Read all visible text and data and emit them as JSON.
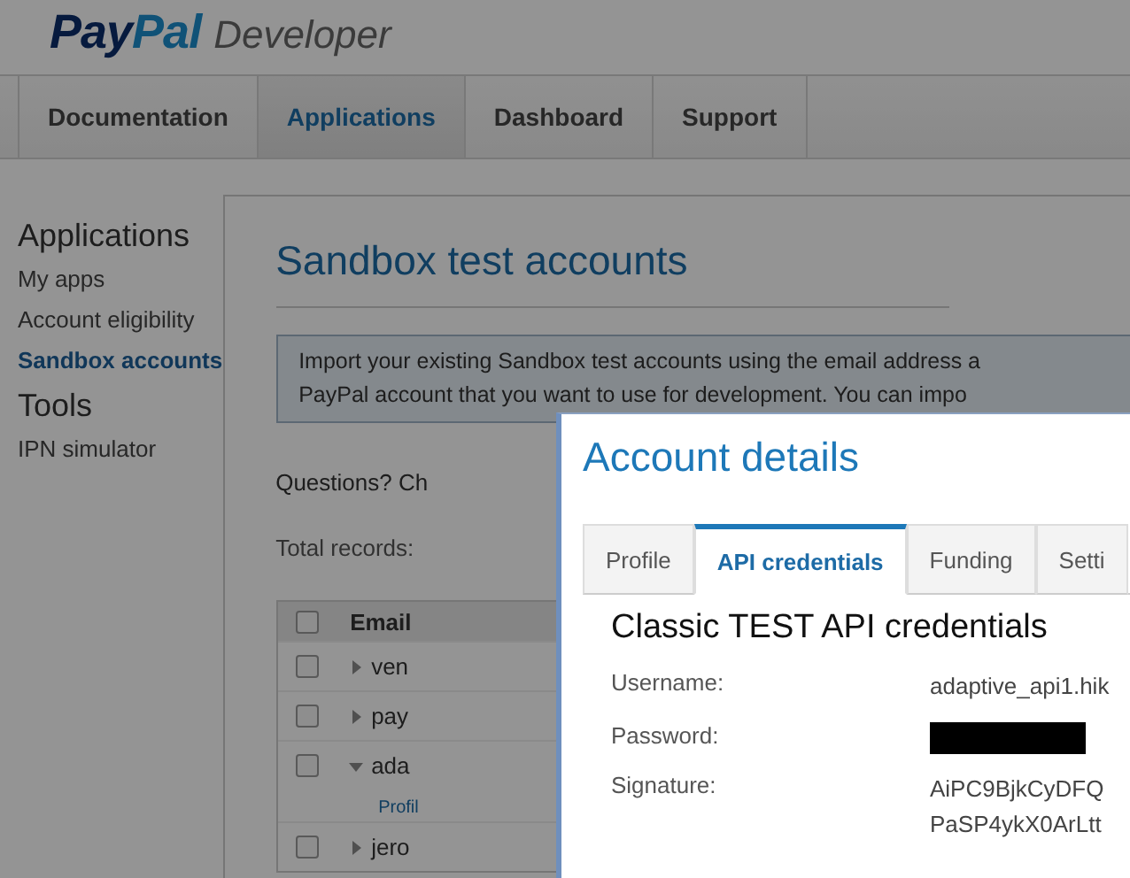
{
  "header": {
    "logo": {
      "brand_first": "Pay",
      "brand_second": "Pal",
      "product": "Developer"
    }
  },
  "nav_tabs": [
    {
      "label": "Documentation",
      "selected": false
    },
    {
      "label": "Applications",
      "selected": true
    },
    {
      "label": "Dashboard",
      "selected": false
    },
    {
      "label": "Support",
      "selected": false
    }
  ],
  "sidebar": {
    "sections": [
      {
        "title": "Applications",
        "items": [
          {
            "label": "My apps",
            "selected": false
          },
          {
            "label": "Account eligibility",
            "selected": false
          },
          {
            "label": "Sandbox accounts",
            "selected": true
          }
        ]
      },
      {
        "title": "Tools",
        "items": [
          {
            "label": "IPN simulator",
            "selected": false
          }
        ]
      }
    ]
  },
  "main": {
    "title": "Sandbox test accounts",
    "notice": [
      "Import your existing Sandbox test accounts using the email address a",
      "PayPal account that you want to use for development. You can impo"
    ],
    "questions": "Questions? Ch",
    "total_records": "Total records:",
    "table": {
      "columns": [
        "Email"
      ],
      "header_checked": false,
      "rows": [
        {
          "email": "ven",
          "checked": false,
          "expanded": false
        },
        {
          "email": "pay",
          "checked": false,
          "expanded": false
        },
        {
          "email": "ada",
          "checked": false,
          "expanded": true,
          "links": [
            "Profil"
          ]
        },
        {
          "email": "jero",
          "checked": false,
          "expanded": false
        }
      ]
    }
  },
  "modal": {
    "title": "Account details",
    "tabs": [
      {
        "label": "Profile",
        "selected": false
      },
      {
        "label": "API credentials",
        "selected": true
      },
      {
        "label": "Funding",
        "selected": false
      },
      {
        "label": "Setti",
        "selected": false
      }
    ],
    "heading": "Classic TEST API credentials",
    "fields": [
      {
        "kind": "text",
        "label": "Username:",
        "lines": [
          "adaptive_api1.hik"
        ]
      },
      {
        "kind": "redacted",
        "label": "Password:"
      },
      {
        "kind": "text",
        "label": "Signature:",
        "lines": [
          "AiPC9BjkCyDFQ",
          "PaSP4ykX0ArLtt"
        ]
      }
    ]
  }
}
